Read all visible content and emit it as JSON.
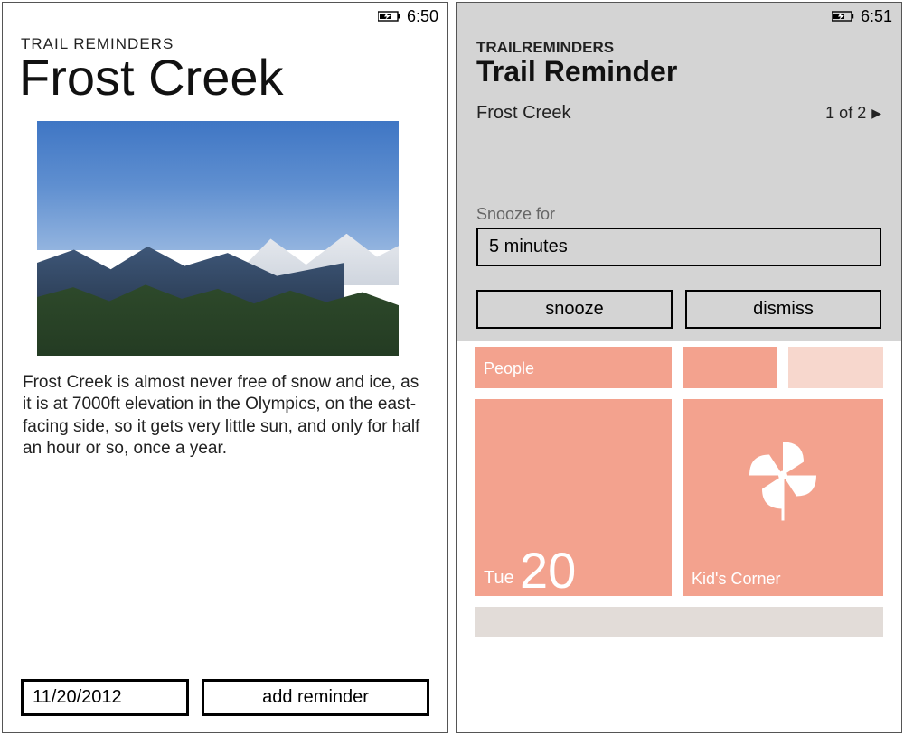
{
  "left": {
    "status_time": "6:50",
    "app_header": "TRAIL REMINDERS",
    "page_title": "Frost Creek",
    "description": "Frost Creek is almost never free of snow and ice, as it is at 7000ft elevation in the Olympics, on the east-facing side, so it gets very little sun, and only for half an hour or so, once a year.",
    "date_value": "11/20/2012",
    "add_reminder_label": "add reminder"
  },
  "right": {
    "status_time": "6:51",
    "app_header": "TRAILREMINDERS",
    "overlay_title": "Trail Reminder",
    "subject": "Frost Creek",
    "counter": "1 of 2",
    "snooze_label": "Snooze for",
    "snooze_value": "5 minutes",
    "snooze_btn": "snooze",
    "dismiss_btn": "dismiss",
    "tiles": {
      "people": "People",
      "cal_day": "Tue",
      "cal_num": "20",
      "kids": "Kid's Corner"
    }
  }
}
